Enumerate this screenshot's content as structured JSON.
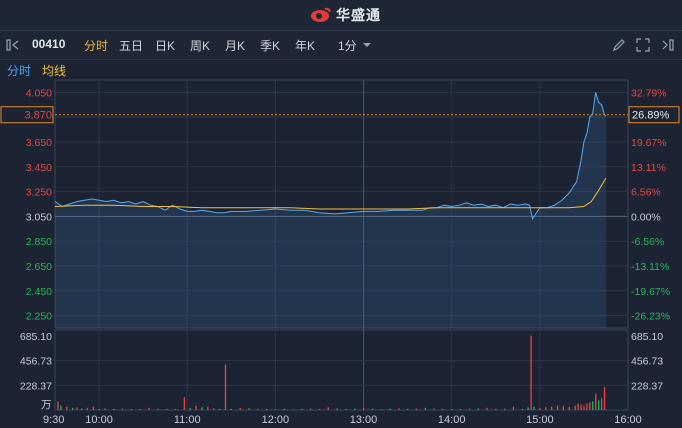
{
  "app": {
    "brand": "华盛通"
  },
  "toolbar": {
    "code": "00410",
    "tabs": [
      {
        "label": "分时",
        "active": true
      },
      {
        "label": "五日",
        "active": false
      },
      {
        "label": "日K",
        "active": false
      },
      {
        "label": "周K",
        "active": false
      },
      {
        "label": "月K",
        "active": false
      },
      {
        "label": "季K",
        "active": false
      },
      {
        "label": "年K",
        "active": false
      }
    ],
    "interval": "1分"
  },
  "subtabs": {
    "timeshare": "分时",
    "avg_line": "均线"
  },
  "colors": {
    "price_line": "#5aa9f0",
    "avg_line": "#f0c040",
    "up": "#e64545",
    "down": "#28b45a",
    "tab_active": "#f3b23e",
    "cursor": "#e08a2c"
  },
  "chart_data": {
    "type": "line",
    "prev_close": 3.05,
    "price_ticks": [
      "4.050",
      "3.650",
      "3.450",
      "3.250",
      "3.050",
      "2.850",
      "2.650",
      "2.450",
      "2.250"
    ],
    "pct_ticks": [
      "32.79%",
      "19.67%",
      "13.11%",
      "6.56%",
      "0.00%",
      "-6.56%",
      "-13.11%",
      "-19.67%",
      "-26.23%"
    ],
    "cursor_price": "3.870",
    "cursor_pct": "26.89%",
    "volume_ticks": [
      "685.10",
      "456.73",
      "228.37"
    ],
    "volume_max": 685.1,
    "volume_unit": "万",
    "time_labels": [
      "9:30",
      "10:00",
      "11:00",
      "12:00",
      "13:00",
      "14:00",
      "15:00",
      "16:00"
    ],
    "time_minutes": [
      0,
      30,
      90,
      150,
      210,
      270,
      330,
      390
    ],
    "price_series": {
      "name": "price",
      "t": [
        0,
        5,
        10,
        15,
        20,
        25,
        30,
        35,
        40,
        45,
        50,
        55,
        60,
        65,
        70,
        75,
        80,
        85,
        90,
        95,
        100,
        105,
        110,
        115,
        120,
        130,
        140,
        150,
        160,
        170,
        180,
        190,
        200,
        210,
        220,
        230,
        240,
        250,
        255,
        260,
        265,
        270,
        275,
        280,
        285,
        290,
        295,
        300,
        305,
        310,
        315,
        320,
        323,
        325,
        330,
        335,
        340,
        345,
        350,
        355,
        358,
        360,
        362,
        364,
        366,
        368,
        370,
        372,
        374,
        375
      ],
      "v": [
        3.17,
        3.13,
        3.15,
        3.17,
        3.18,
        3.19,
        3.18,
        3.17,
        3.18,
        3.16,
        3.17,
        3.15,
        3.17,
        3.14,
        3.13,
        3.1,
        3.14,
        3.11,
        3.09,
        3.09,
        3.1,
        3.09,
        3.08,
        3.08,
        3.09,
        3.09,
        3.1,
        3.11,
        3.1,
        3.1,
        3.08,
        3.07,
        3.08,
        3.09,
        3.09,
        3.1,
        3.1,
        3.1,
        3.12,
        3.12,
        3.14,
        3.13,
        3.14,
        3.16,
        3.14,
        3.15,
        3.13,
        3.14,
        3.12,
        3.15,
        3.14,
        3.15,
        3.14,
        3.03,
        3.12,
        3.12,
        3.14,
        3.18,
        3.24,
        3.33,
        3.5,
        3.65,
        3.72,
        3.85,
        3.88,
        4.05,
        3.97,
        3.95,
        3.87,
        3.86
      ]
    },
    "avg_series": {
      "name": "avg",
      "t": [
        0,
        20,
        40,
        60,
        80,
        100,
        120,
        140,
        160,
        180,
        200,
        220,
        240,
        260,
        280,
        300,
        320,
        340,
        350,
        360,
        365,
        370,
        375
      ],
      "v": [
        3.13,
        3.14,
        3.14,
        3.13,
        3.13,
        3.12,
        3.12,
        3.12,
        3.12,
        3.11,
        3.11,
        3.11,
        3.11,
        3.12,
        3.12,
        3.12,
        3.12,
        3.12,
        3.12,
        3.13,
        3.17,
        3.26,
        3.36
      ]
    },
    "volume_series": {
      "name": "volume",
      "t": [
        2,
        4,
        8,
        12,
        15,
        18,
        22,
        26,
        30,
        34,
        40,
        46,
        52,
        58,
        64,
        70,
        76,
        82,
        88,
        92,
        96,
        100,
        104,
        108,
        112,
        116,
        120,
        126,
        132,
        138,
        144,
        150,
        156,
        162,
        168,
        174,
        180,
        186,
        192,
        198,
        204,
        210,
        216,
        222,
        228,
        234,
        240,
        246,
        252,
        258,
        264,
        270,
        276,
        282,
        288,
        294,
        300,
        306,
        312,
        318,
        322,
        324,
        326,
        330,
        334,
        338,
        342,
        346,
        350,
        354,
        356,
        358,
        360,
        362,
        364,
        366,
        368,
        370,
        372,
        374
      ],
      "v": [
        80,
        40,
        30,
        20,
        25,
        15,
        20,
        30,
        10,
        15,
        10,
        12,
        8,
        10,
        20,
        12,
        10,
        8,
        120,
        20,
        40,
        25,
        30,
        15,
        10,
        420,
        10,
        20,
        15,
        12,
        10,
        8,
        10,
        6,
        10,
        12,
        8,
        25,
        15,
        10,
        12,
        20,
        10,
        8,
        12,
        15,
        10,
        12,
        20,
        15,
        12,
        10,
        8,
        12,
        15,
        20,
        10,
        12,
        30,
        10,
        25,
        690,
        30,
        20,
        25,
        30,
        40,
        35,
        30,
        40,
        60,
        50,
        40,
        60,
        70,
        80,
        150,
        90,
        110,
        210
      ],
      "up": [
        true,
        false,
        true,
        false,
        true,
        false,
        true,
        true,
        false,
        true,
        false,
        true,
        false,
        true,
        true,
        false,
        true,
        false,
        true,
        false,
        true,
        false,
        true,
        false,
        true,
        true,
        false,
        true,
        false,
        true,
        false,
        true,
        false,
        true,
        false,
        true,
        false,
        true,
        false,
        true,
        false,
        true,
        false,
        true,
        false,
        true,
        false,
        true,
        false,
        true,
        false,
        true,
        false,
        true,
        false,
        true,
        false,
        true,
        true,
        false,
        false,
        true,
        false,
        true,
        true,
        true,
        true,
        true,
        true,
        true,
        true,
        true,
        true,
        true,
        true,
        false,
        true,
        false,
        true,
        true
      ]
    }
  }
}
